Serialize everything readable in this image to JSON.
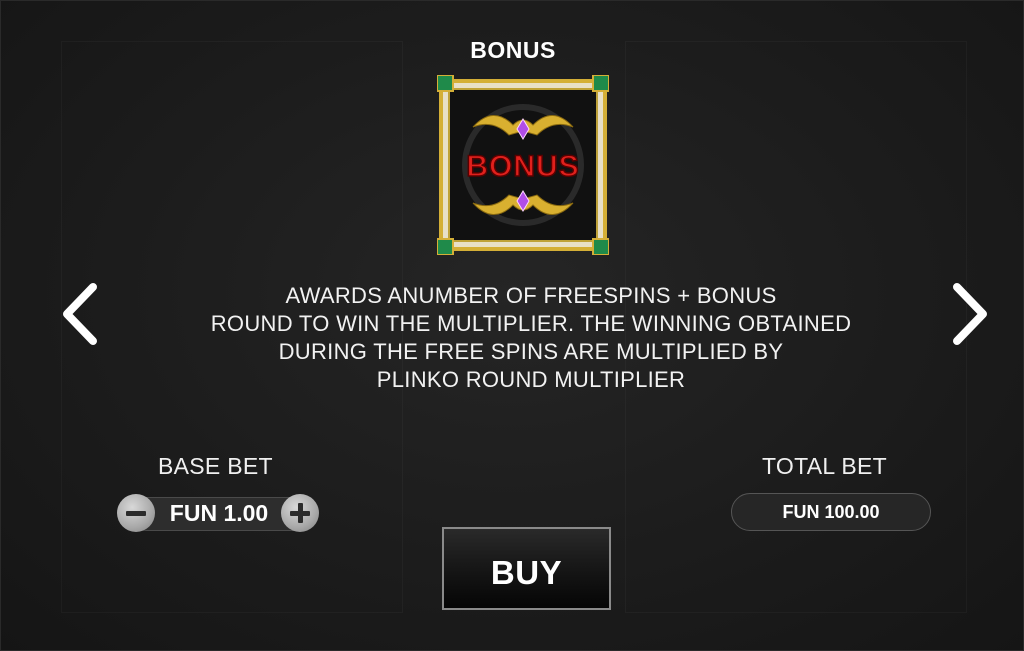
{
  "title": "BONUS",
  "symbol": {
    "icon": "bonus-symbol-icon",
    "text": "BONUS",
    "colors": {
      "frame": "#d4af37",
      "text": "#e0201c",
      "gem": "#b14de8",
      "corner_gem": "#1f8a4a"
    }
  },
  "description": {
    "lines": [
      "AWARDS ANUMBER OF FREESPINS + BONUS",
      "ROUND TO WIN THE MULTIPLIER. THE WINNING OBTAINED",
      "DURING THE FREE SPINS ARE MULTIPLIED BY",
      "PLINKO ROUND MULTIPLIER"
    ]
  },
  "nav": {
    "prev_icon": "chevron-left-icon",
    "next_icon": "chevron-right-icon"
  },
  "base_bet": {
    "label": "BASE BET",
    "value": "FUN 1.00",
    "minus_icon": "minus-icon",
    "plus_icon": "plus-icon"
  },
  "total_bet": {
    "label": "TOTAL BET",
    "value": "FUN 100.00"
  },
  "buy_button": {
    "label": "BUY"
  }
}
